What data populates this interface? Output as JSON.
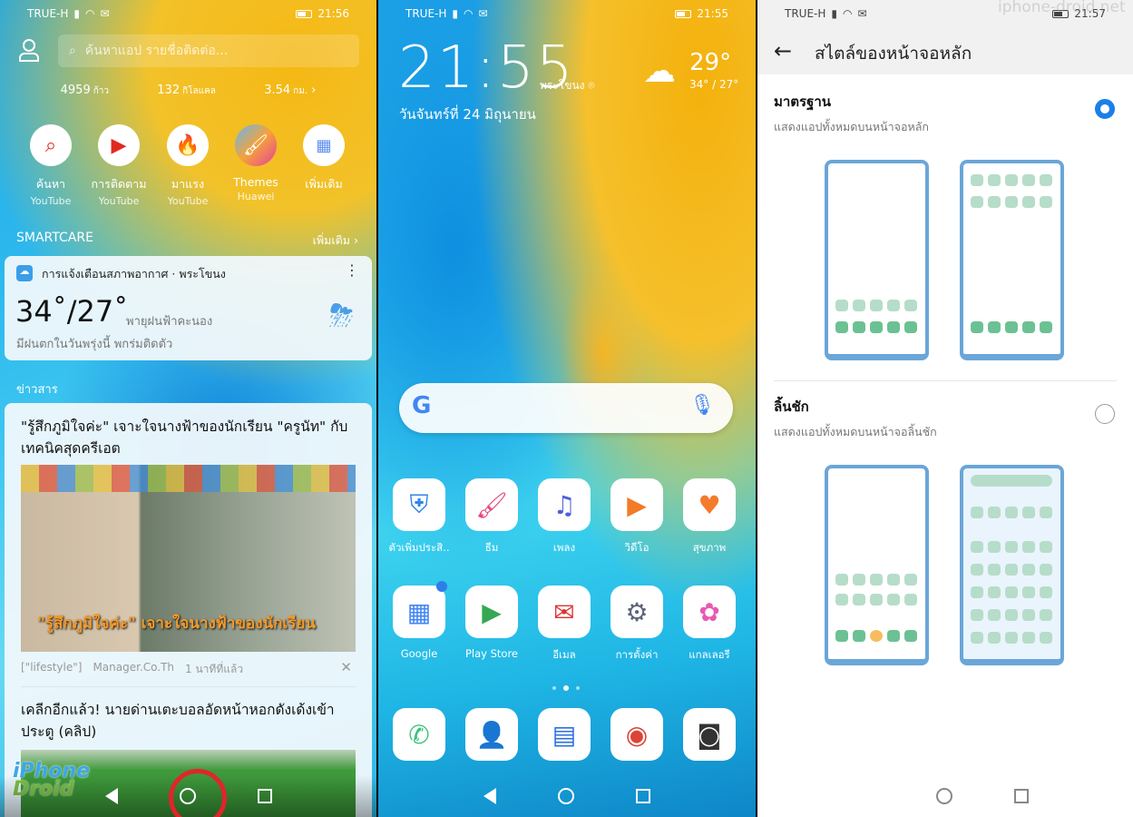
{
  "watermark": "iphone-droid.net",
  "panel_left": {
    "status": {
      "carrier": "TRUE-H",
      "time": "21:56"
    },
    "search_placeholder": "ค้นหาแอป รายชื่อติดต่อ...",
    "stats": [
      {
        "value": "4959",
        "unit": "ก้าว"
      },
      {
        "value": "132",
        "unit": "กิโลแคล"
      },
      {
        "value": "3.54",
        "unit": "กม."
      }
    ],
    "shortcuts": [
      {
        "title": "ค้นหา",
        "sub": "YouTube",
        "icon": "search-icon"
      },
      {
        "title": "การติดตาม",
        "sub": "YouTube",
        "icon": "subscriptions-icon"
      },
      {
        "title": "มาแรง",
        "sub": "YouTube",
        "icon": "trending-flame-icon"
      },
      {
        "title": "Themes",
        "sub": "Huawei",
        "icon": "paintbrush-icon"
      },
      {
        "title": "เพิ่มเติม",
        "sub": "",
        "icon": "more-grid-icon"
      }
    ],
    "smartcare": {
      "title": "SMARTCARE",
      "more": "เพิ่มเติม"
    },
    "weather_card": {
      "header": "การแจ้งเตือนสภาพอากาศ · พระโขนง",
      "temp": "34˚/27˚",
      "condition": "พายุฝนฟ้าคะนอง",
      "note": "มีฝนตกในวันพรุ่งนี้ พกร่มติดตัว"
    },
    "news_label": "ข่าวสาร",
    "news": [
      {
        "title": "\"รู้สึกภูมิใจค่ะ\" เจาะใจนางฟ้าของนักเรียน \"ครูนัท\" กับเทคนิคสุดครีเอต",
        "image_caption": "\"รู้สึกภูมิใจค่ะ\" เจาะใจนางฟ้าของนักเรียน",
        "tag": "[\"lifestyle\"]",
        "source": "Manager.Co.Th",
        "time": "1 นาทีที่แล้ว"
      },
      {
        "title": "เคลีกอีกแล้ว! นายด่านเตะบอลอัดหน้าหอกดังเด้งเข้าประตู (คลิป)"
      }
    ],
    "logo_text": "iPhone Droid"
  },
  "panel_middle": {
    "status": {
      "carrier": "TRUE-H",
      "time": "21:55"
    },
    "clock": "21:55",
    "location": "พระโขนง",
    "date": "วันจันทร์ที่ 24 มิถุนายน",
    "weather": {
      "temp": "29°",
      "range": "34° / 27°"
    },
    "apps_row1": [
      {
        "label": "ตัวเพิ่มประสิ..",
        "icon": "shield-icon",
        "color": "#2f86e6"
      },
      {
        "label": "ธีม",
        "icon": "paintbrush-icon",
        "color": "#e8457a"
      },
      {
        "label": "เพลง",
        "icon": "music-note-icon",
        "color": "#4a5fe0"
      },
      {
        "label": "วิดีโอ",
        "icon": "video-play-icon",
        "color": "#f27a28"
      },
      {
        "label": "สุขภาพ",
        "icon": "heart-icon",
        "color": "#f47a2c"
      }
    ],
    "apps_row2": [
      {
        "label": "Google",
        "icon": "folder-icon",
        "color": "#4285f4"
      },
      {
        "label": "Play Store",
        "icon": "play-store-icon",
        "color": "#34a853"
      },
      {
        "label": "อีเมล",
        "icon": "envelope-icon",
        "color": "#d33"
      },
      {
        "label": "การตั้งค่า",
        "icon": "gear-icon",
        "color": "#5c6578"
      },
      {
        "label": "แกลเลอรี",
        "icon": "gallery-flower-icon",
        "color": "#e85ab0"
      }
    ],
    "dock": [
      {
        "icon": "phone-icon",
        "color": "#3cc17a"
      },
      {
        "icon": "contacts-icon",
        "color": "#2e7de8"
      },
      {
        "icon": "messages-icon",
        "color": "#2d6fe0"
      },
      {
        "icon": "chrome-icon",
        "color": "#db4437"
      },
      {
        "icon": "camera-icon",
        "color": "#333"
      }
    ]
  },
  "panel_right": {
    "status": {
      "carrier": "TRUE-H",
      "time": "21:57"
    },
    "title": "สไตล์ของหน้าจอหลัก",
    "options": [
      {
        "title": "มาตรฐาน",
        "subtitle": "แสดงแอปทั้งหมดบนหน้าจอหลัก",
        "selected": true
      },
      {
        "title": "ลิ้นชัก",
        "subtitle": "แสดงแอปทั้งหมดบนหน้าจอลิ้นชัก",
        "selected": false
      }
    ],
    "accent": "#1a7fe8"
  }
}
